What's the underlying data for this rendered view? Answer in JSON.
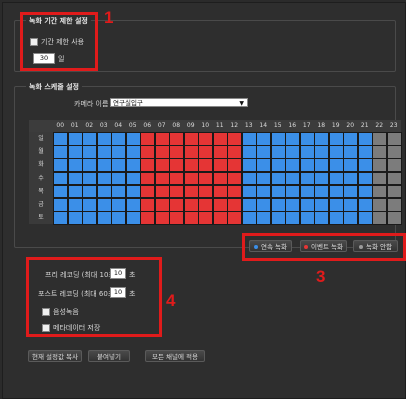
{
  "colors": {
    "continuous": "#3b8fe8",
    "event": "#e53535",
    "none": "#7c7c7c",
    "annotation": "#e01b1b"
  },
  "recording_period": {
    "title": "녹화 기간 제한 설정",
    "checkbox_label": "기간 제한 사용",
    "days_value": "30",
    "days_unit": "일"
  },
  "schedule": {
    "title": "녹화 스케줄 설정",
    "camera_label": "카메라 이름",
    "camera_value": "연구실입구",
    "hours": [
      "00",
      "01",
      "02",
      "03",
      "04",
      "05",
      "06",
      "07",
      "08",
      "09",
      "10",
      "11",
      "12",
      "13",
      "14",
      "15",
      "16",
      "17",
      "18",
      "19",
      "20",
      "21",
      "22",
      "23"
    ],
    "days": [
      "일",
      "월",
      "화",
      "수",
      "목",
      "금",
      "토"
    ],
    "hour_modes": [
      "continuous",
      "continuous",
      "continuous",
      "continuous",
      "continuous",
      "continuous",
      "event",
      "event",
      "event",
      "event",
      "event",
      "event",
      "event",
      "continuous",
      "continuous",
      "continuous",
      "continuous",
      "continuous",
      "continuous",
      "continuous",
      "continuous",
      "continuous",
      "none",
      "none"
    ],
    "legend": [
      {
        "label": "연속 녹화",
        "icon": "blue-dot-icon"
      },
      {
        "label": "이벤트 녹화",
        "icon": "red-dot-icon"
      },
      {
        "label": "녹화 안함",
        "icon": "gray-dot-icon"
      }
    ]
  },
  "event_settings": {
    "pre_label": "프리 레코딩 (최대 10초)",
    "pre_value": "10",
    "pre_unit": "초",
    "post_label": "포스트 레코딩 (최대 60초)",
    "post_value": "10",
    "post_unit": "초",
    "audio_label": "음성녹음",
    "metadata_label": "메타데이터 저장"
  },
  "buttons": {
    "copy": "현재 설정값 복사",
    "paste": "붙여넣기",
    "apply_all": "모든 채널에 적용"
  },
  "annotations": [
    "1",
    "3",
    "4"
  ]
}
